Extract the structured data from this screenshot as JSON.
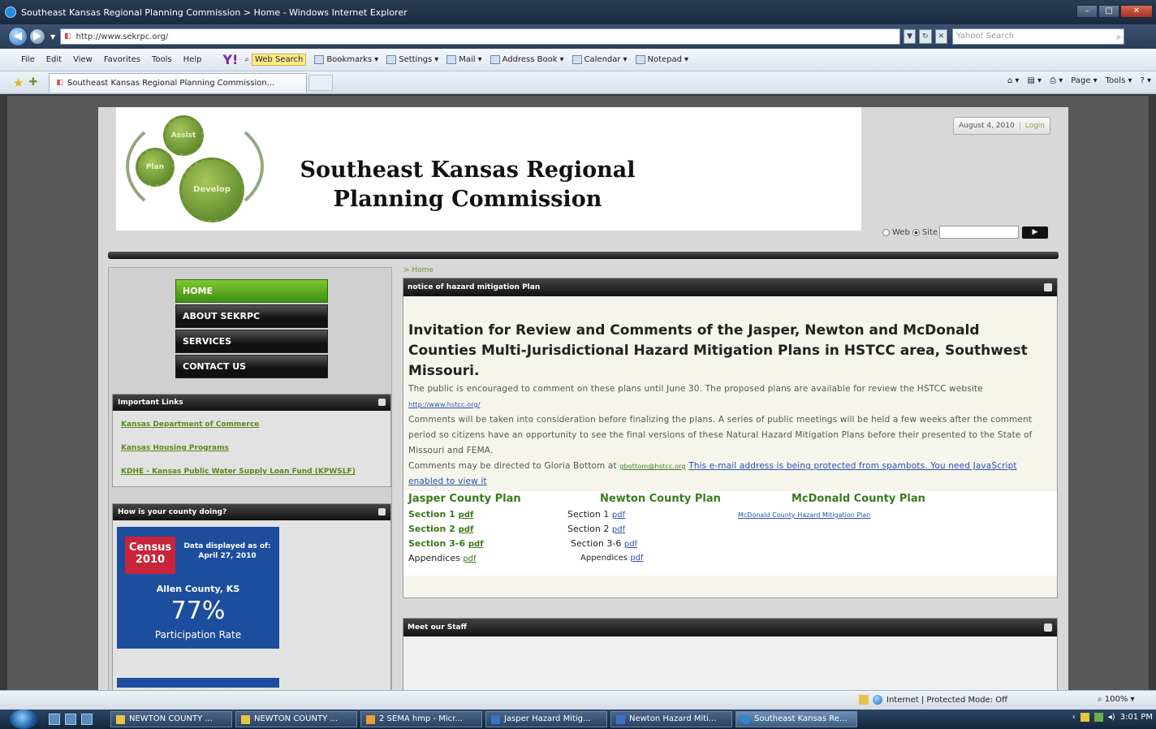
{
  "window": {
    "title": "Southeast Kansas Regional Planning Commission > Home - Windows Internet Explorer",
    "url": "http://www.sekrpc.org/",
    "search_placeholder": "Yahoo! Search"
  },
  "menu": [
    "File",
    "Edit",
    "View",
    "Favorites",
    "Tools",
    "Help"
  ],
  "toolbar": {
    "yahoo": "Y!",
    "web_search": "Web Search",
    "bookmarks": "Bookmarks",
    "settings": "Settings",
    "mail": "Mail",
    "address_book": "Address Book",
    "calendar": "Calendar",
    "notepad": "Notepad"
  },
  "tab": {
    "label": "Southeast Kansas Regional Planning Commission..."
  },
  "commandbar": {
    "page": "Page",
    "tools": "Tools"
  },
  "site": {
    "title_line1": "Southeast Kansas Regional",
    "title_line2": "Planning Commission",
    "gears": [
      "Assist",
      "Plan",
      "Develop"
    ],
    "date": "August 4, 2010",
    "login": "Login",
    "search_web": "Web",
    "search_site": "Site"
  },
  "nav": [
    "HOME",
    "ABOUT SEKRPC",
    "SERVICES",
    "CONTACT US"
  ],
  "important_links": {
    "title": "Important Links",
    "items": [
      "Kansas Department of Commerce",
      "Kansas Housing Programs",
      "KDHE - Kansas Public Water Supply Loan Fund (KPWSLF)"
    ]
  },
  "county_panel": {
    "title": "How is your county doing?",
    "logo_top": "Census",
    "logo_year": "2010",
    "as_of": "Data displayed as of:\nApril 27, 2010",
    "county": "Allen County, KS",
    "percent": "77%",
    "rate_label": "Participation Rate"
  },
  "breadcrumb": "> Home",
  "article": {
    "title": "notice of hazard mitigation Plan",
    "headline": "Invitation for Review and Comments of the Jasper, Newton and McDonald Counties Multi-Jurisdictional Hazard Mitigation Plans in HSTCC area, Southwest Missouri.",
    "p1": "The public is encouraged to comment on these plans until June 30. The proposed plans are available for review the HSTCC website",
    "p1_link": "http://www.hstcc.org/",
    "p2": "Comments will be taken into consideration before finalizing the plans. A series of public meetings will be held a few weeks after the comment period so citizens have an opportunity to see the final versions of these Natural Hazard Mitigation Plans before their presented to the State of Missouri and FEMA.",
    "p3_prefix": "Comments may be directed to Gloria Bottom at",
    "p3_email": "gbottom@hstcc.org",
    "p3_spam": "This e-mail address is being protected from spambots. You need JavaScript enabled to view it",
    "jasper": {
      "heading": "Jasper County Plan",
      "rows": [
        [
          "Section 1",
          "pdf"
        ],
        [
          "Section 2",
          "pdf"
        ],
        [
          "Section 3-6",
          "pdf"
        ],
        [
          "Appendices",
          "pdf"
        ]
      ]
    },
    "newton": {
      "heading": "Newton County Plan",
      "rows": [
        [
          "Section 1",
          "pdf"
        ],
        [
          "Section 2",
          "pdf"
        ],
        [
          "Section 3-6",
          "pdf"
        ],
        [
          "Appendices",
          "pdf"
        ]
      ]
    },
    "mcdonald": {
      "heading": "McDonald County Plan",
      "link": "McDonald County Hazard Mitigation Plan"
    }
  },
  "staff": {
    "title": "Meet our Staff"
  },
  "status": {
    "zone": "Internet | Protected Mode: Off",
    "zoom": "100%"
  },
  "taskbar": {
    "tasks": [
      "NEWTON COUNTY ...",
      "NEWTON COUNTY ...",
      "2 SEMA hmp - Micr...",
      "Jasper Hazard Mitig...",
      "Newton Hazard Miti...",
      "Southeast Kansas Re..."
    ],
    "clock": "3:01 PM"
  },
  "colors": {
    "accent_green": "#3a7a1a",
    "link_blue": "#2a50b0",
    "census_blue": "#1d4e9e"
  }
}
